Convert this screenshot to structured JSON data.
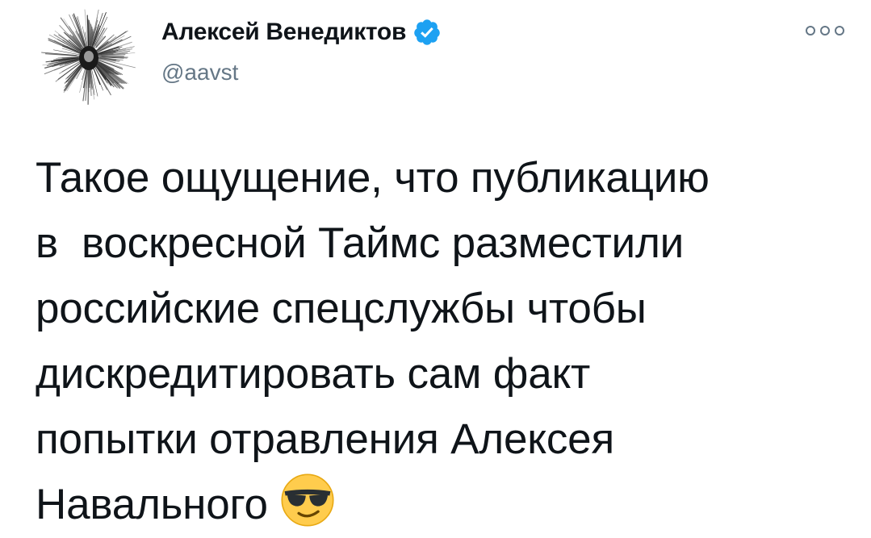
{
  "author": {
    "display_name": "Алексей Венедиктов",
    "handle": "@aavst",
    "verified": true,
    "avatar_icon": "dandelion-portrait-avatar",
    "verified_icon": "verified-badge-icon",
    "verified_color": "#1da1f2"
  },
  "menu": {
    "icon": "more-options-icon"
  },
  "tweet": {
    "lines": [
      "Такое ощущение, что публикацию",
      "в  воскресной Таймс разместили",
      "российские спецслужбы чтобы",
      "дискредитировать сам факт",
      "попытки отравления Алексея",
      "Навального"
    ],
    "emoji": "smiling-face-with-sunglasses-emoji"
  },
  "colors": {
    "text": "#0f1419",
    "secondary": "#657786",
    "background": "#ffffff"
  }
}
